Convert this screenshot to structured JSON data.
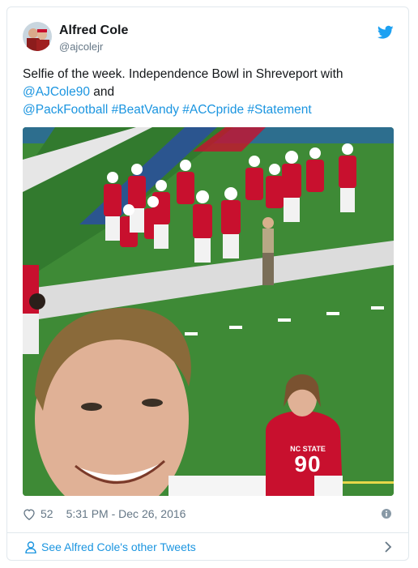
{
  "tweet": {
    "author_name": "Alfred Cole",
    "author_handle": "@ajcolejr",
    "text_plain_1": "Selfie of the week. Independence Bowl in Shreveport with",
    "mention_1": "@AJCole90",
    "text_plain_2": " and",
    "mention_2": "@PackFootball",
    "hashtag_1": "#BeatVandy",
    "hashtag_2": "#ACCpride",
    "hashtag_3": "#Statement",
    "like_count": "52",
    "timestamp": "5:31 PM - Dec 26, 2016",
    "jersey_text": "NC STATE",
    "jersey_number": "90"
  },
  "footer": {
    "see_more": "See Alfred Cole's other Tweets"
  },
  "colors": {
    "link": "#1b95e0",
    "twitter_blue": "#1da1f2",
    "muted": "#657786",
    "turf": "#3e8a36",
    "jersey_red": "#c8102e"
  },
  "icons": {
    "bird": "twitter-bird-icon",
    "heart": "heart-icon",
    "info": "info-icon",
    "person": "person-icon",
    "chevron": "chevron-right-icon"
  }
}
